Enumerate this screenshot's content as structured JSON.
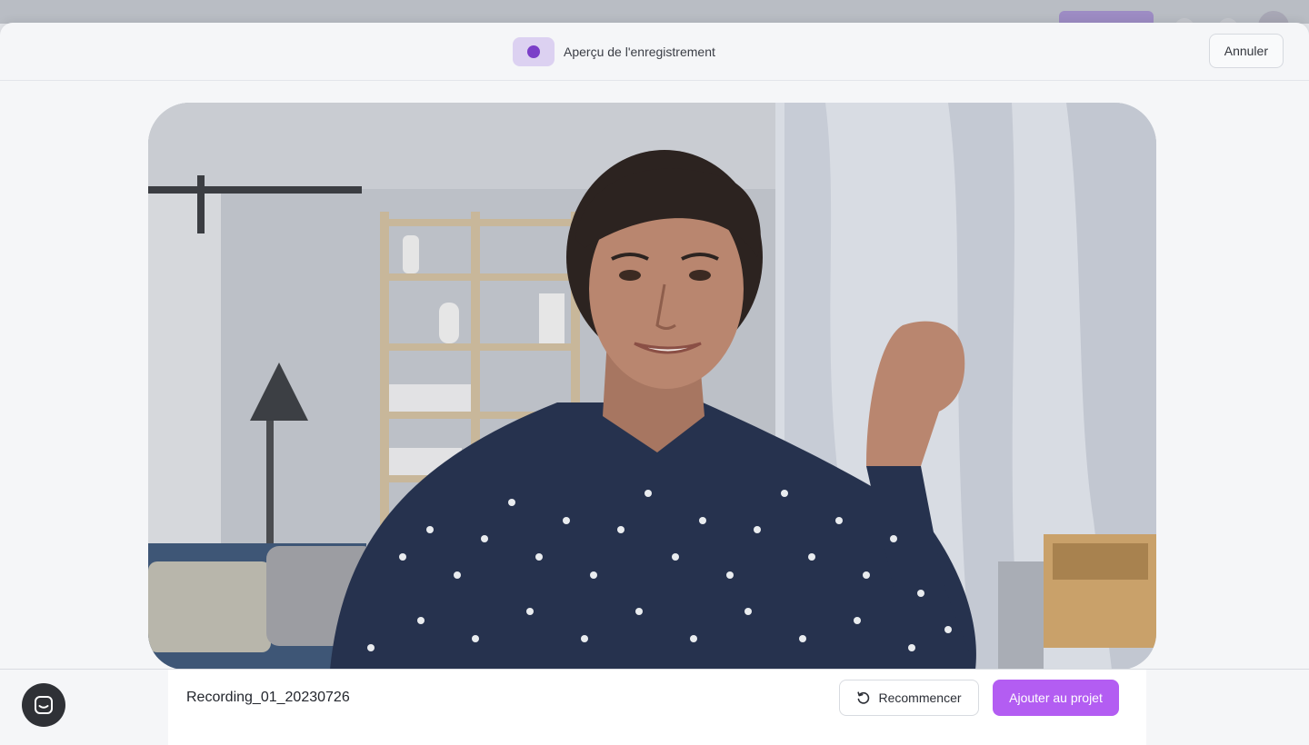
{
  "modal": {
    "title": "Aperçu de l'enregistrement",
    "cancel_label": "Annuler",
    "record_icon": "record-dot-icon",
    "accent_color": "#7b3fc8"
  },
  "video": {
    "description_icon": "video-preview"
  },
  "footer": {
    "recording_name": "Recording_01_20230726",
    "restart_label": "Recommencer",
    "restart_icon": "restart-icon",
    "add_label": "Ajouter au projet",
    "add_color": "#b35df2"
  },
  "chat": {
    "icon": "chat-icon"
  }
}
